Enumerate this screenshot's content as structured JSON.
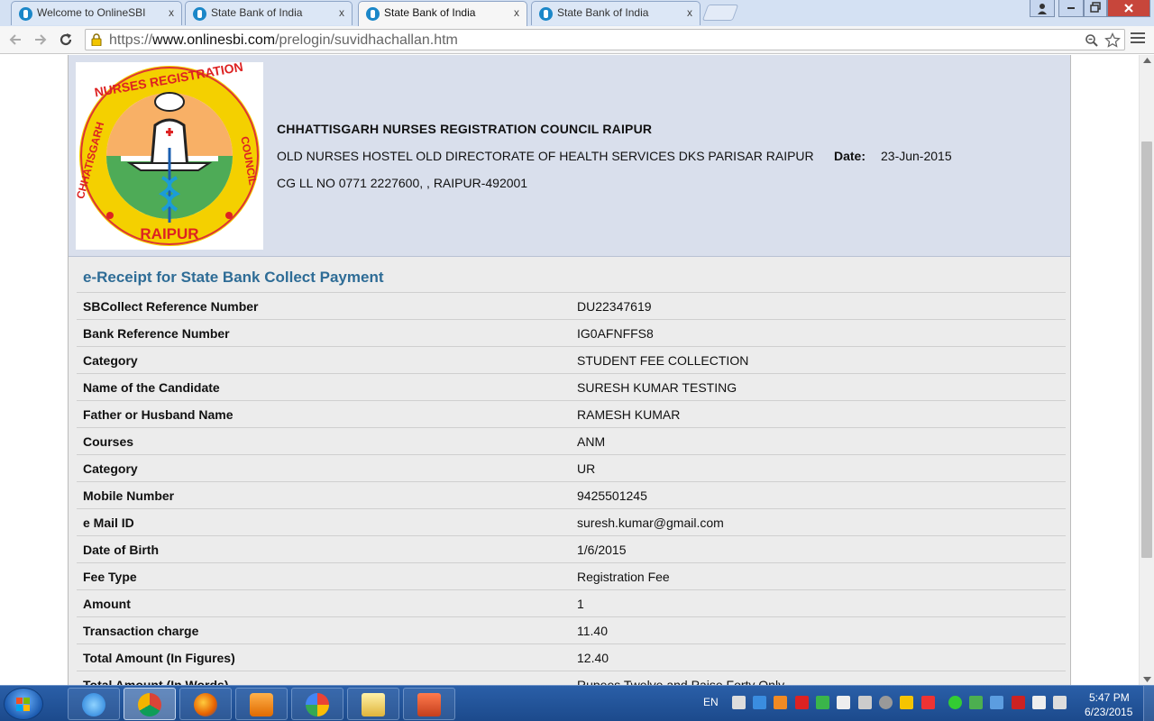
{
  "browser": {
    "tabs": [
      {
        "title": "Welcome to OnlineSBI",
        "active": false
      },
      {
        "title": "State Bank of India",
        "active": false
      },
      {
        "title": "State Bank of India",
        "active": true
      },
      {
        "title": "State Bank of India",
        "active": false
      }
    ],
    "url_scheme": "https://",
    "url_host": "www.onlinesbi.com",
    "url_path": "/prelogin/suvidhachallan.htm",
    "close_glyph": "x"
  },
  "header": {
    "org_name": "CHHATTISGARH NURSES REGISTRATION COUNCIL RAIPUR",
    "address": "OLD NURSES HOSTEL OLD DIRECTORATE OF HEALTH SERVICES DKS PARISAR RAIPUR",
    "contact": "CG LL NO 0771 2227600, , RAIPUR-492001",
    "date_label": "Date:",
    "date_value": "23-Jun-2015"
  },
  "receipt": {
    "title": "e-Receipt for State Bank Collect Payment",
    "rows": [
      {
        "label": "SBCollect Reference Number",
        "value": "DU22347619"
      },
      {
        "label": "Bank Reference Number",
        "value": "IG0AFNFFS8"
      },
      {
        "label": "Category",
        "value": "STUDENT FEE COLLECTION"
      },
      {
        "label": "Name of the Candidate",
        "value": "SURESH KUMAR TESTING"
      },
      {
        "label": "Father or Husband Name",
        "value": "RAMESH KUMAR"
      },
      {
        "label": "Courses",
        "value": "ANM"
      },
      {
        "label": "Category",
        "value": "UR"
      },
      {
        "label": "Mobile Number",
        "value": "9425501245"
      },
      {
        "label": "e Mail ID",
        "value": "suresh.kumar@gmail.com"
      },
      {
        "label": "Date of Birth",
        "value": "1/6/2015"
      },
      {
        "label": "Fee Type",
        "value": "Registration Fee"
      },
      {
        "label": "Amount",
        "value": "1"
      },
      {
        "label": "Transaction charge",
        "value": "11.40"
      },
      {
        "label": "Total Amount (In Figures)",
        "value": "12.40"
      },
      {
        "label": "Total Amount (In Words)",
        "value": "Rupees Twelve and Paise Forty Only"
      }
    ]
  },
  "taskbar": {
    "items": [
      {
        "name": "internet-explorer",
        "active": false
      },
      {
        "name": "chrome",
        "active": true
      },
      {
        "name": "firefox",
        "active": false
      },
      {
        "name": "media-player",
        "active": false
      },
      {
        "name": "photos",
        "active": false
      },
      {
        "name": "file-explorer",
        "active": false
      },
      {
        "name": "powerpoint",
        "active": false
      }
    ],
    "language": "EN",
    "time": "5:47 PM",
    "date": "6/23/2015"
  },
  "colors": {
    "header_bg": "#d9dfec",
    "body_bg": "#ececec",
    "title_blue": "#2e6c96",
    "taskbar_blue": "#1c4a8c"
  }
}
